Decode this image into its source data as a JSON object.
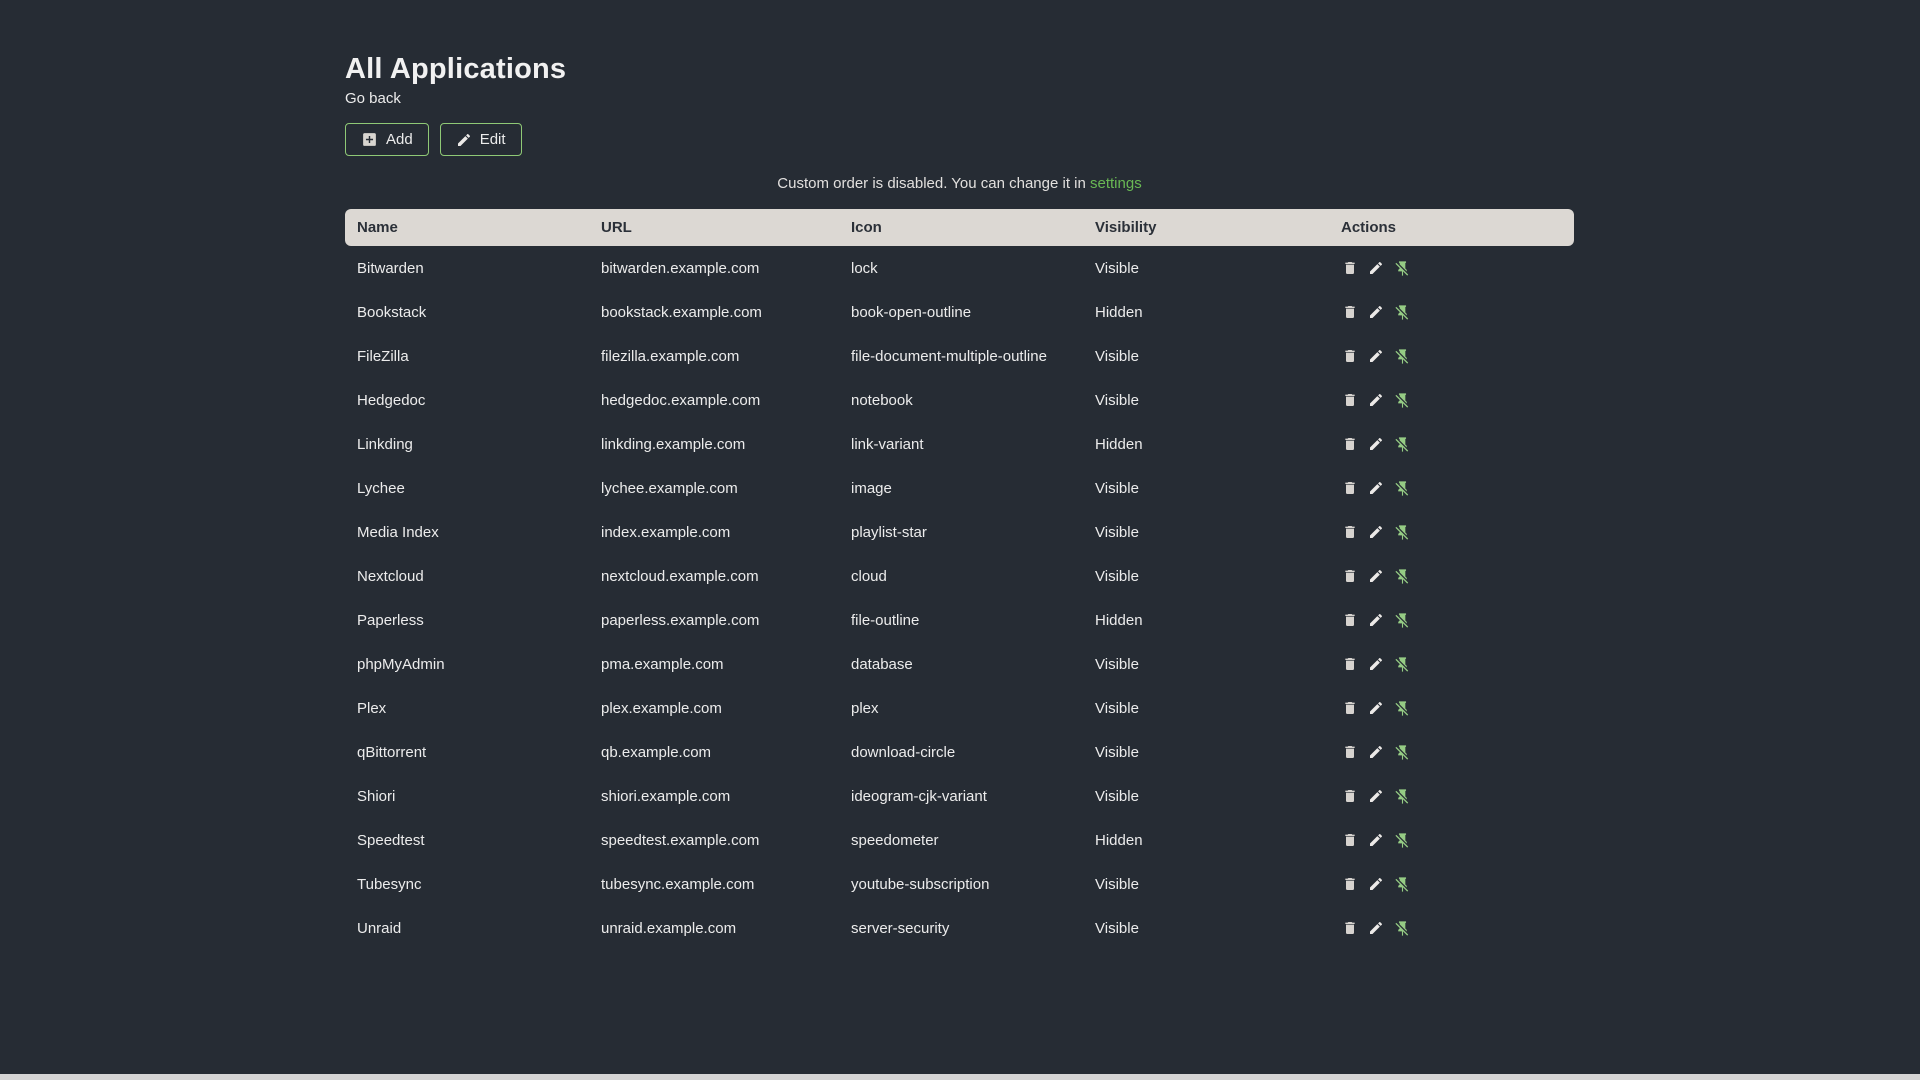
{
  "page": {
    "title": "All Applications",
    "back_link": "Go back",
    "buttons": {
      "add": "Add",
      "edit": "Edit"
    },
    "notice": {
      "text": "Custom order is disabled. You can change it in ",
      "link": "settings"
    }
  },
  "colors": {
    "background": "#262c34",
    "text": "#ececec",
    "header_bg": "#dcd8d3",
    "header_text": "#2b3038",
    "accent_green": "#8fc976",
    "link_green": "#69b854",
    "pin_green": "#95cc84"
  },
  "table": {
    "headers": [
      "Name",
      "URL",
      "Icon",
      "Visibility",
      "Actions"
    ],
    "action_icons": [
      "delete",
      "edit",
      "unpin"
    ],
    "rows": [
      {
        "name": "Bitwarden",
        "url": "bitwarden.example.com",
        "icon": "lock",
        "visibility": "Visible"
      },
      {
        "name": "Bookstack",
        "url": "bookstack.example.com",
        "icon": "book-open-outline",
        "visibility": "Hidden"
      },
      {
        "name": "FileZilla",
        "url": "filezilla.example.com",
        "icon": "file-document-multiple-outline",
        "visibility": "Visible"
      },
      {
        "name": "Hedgedoc",
        "url": "hedgedoc.example.com",
        "icon": "notebook",
        "visibility": "Visible"
      },
      {
        "name": "Linkding",
        "url": "linkding.example.com",
        "icon": "link-variant",
        "visibility": "Hidden"
      },
      {
        "name": "Lychee",
        "url": "lychee.example.com",
        "icon": "image",
        "visibility": "Visible"
      },
      {
        "name": "Media Index",
        "url": "index.example.com",
        "icon": "playlist-star",
        "visibility": "Visible"
      },
      {
        "name": "Nextcloud",
        "url": "nextcloud.example.com",
        "icon": "cloud",
        "visibility": "Visible"
      },
      {
        "name": "Paperless",
        "url": "paperless.example.com",
        "icon": "file-outline",
        "visibility": "Hidden"
      },
      {
        "name": "phpMyAdmin",
        "url": "pma.example.com",
        "icon": "database",
        "visibility": "Visible"
      },
      {
        "name": "Plex",
        "url": "plex.example.com",
        "icon": "plex",
        "visibility": "Visible"
      },
      {
        "name": "qBittorrent",
        "url": "qb.example.com",
        "icon": "download-circle",
        "visibility": "Visible"
      },
      {
        "name": "Shiori",
        "url": "shiori.example.com",
        "icon": "ideogram-cjk-variant",
        "visibility": "Visible"
      },
      {
        "name": "Speedtest",
        "url": "speedtest.example.com",
        "icon": "speedometer",
        "visibility": "Hidden"
      },
      {
        "name": "Tubesync",
        "url": "tubesync.example.com",
        "icon": "youtube-subscription",
        "visibility": "Visible"
      },
      {
        "name": "Unraid",
        "url": "unraid.example.com",
        "icon": "server-security",
        "visibility": "Visible"
      }
    ]
  }
}
